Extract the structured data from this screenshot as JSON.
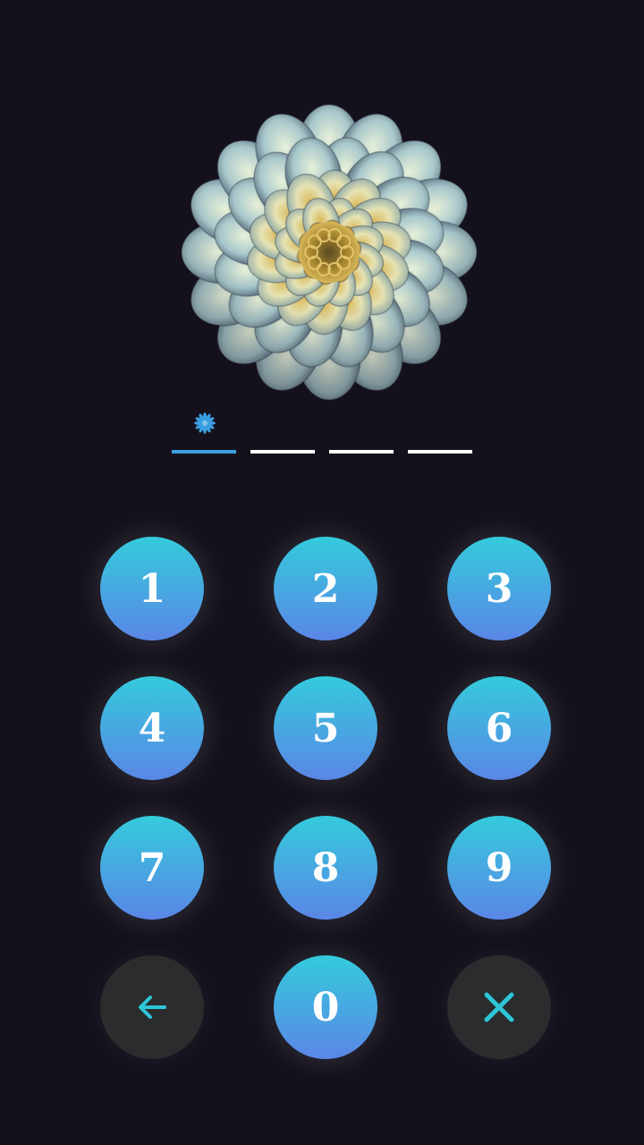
{
  "pin": {
    "slots_total": 4,
    "slots_filled": 1,
    "entered_marker_icon": "flower-dot-icon"
  },
  "keypad": {
    "keys": [
      {
        "label": "1"
      },
      {
        "label": "2"
      },
      {
        "label": "3"
      },
      {
        "label": "4"
      },
      {
        "label": "5"
      },
      {
        "label": "6"
      },
      {
        "label": "7"
      },
      {
        "label": "8"
      },
      {
        "label": "9"
      },
      {
        "label": "0"
      }
    ],
    "backspace_icon": "arrow-left-icon",
    "clear_icon": "close-icon"
  },
  "colors": {
    "background": "#14111c",
    "key_gradient_top": "#34cbdc",
    "key_gradient_bottom": "#5a86e6",
    "accent": "#3a9fe0",
    "icon_teal": "#2ec6d6",
    "dark_key": "#2a2c2e"
  }
}
